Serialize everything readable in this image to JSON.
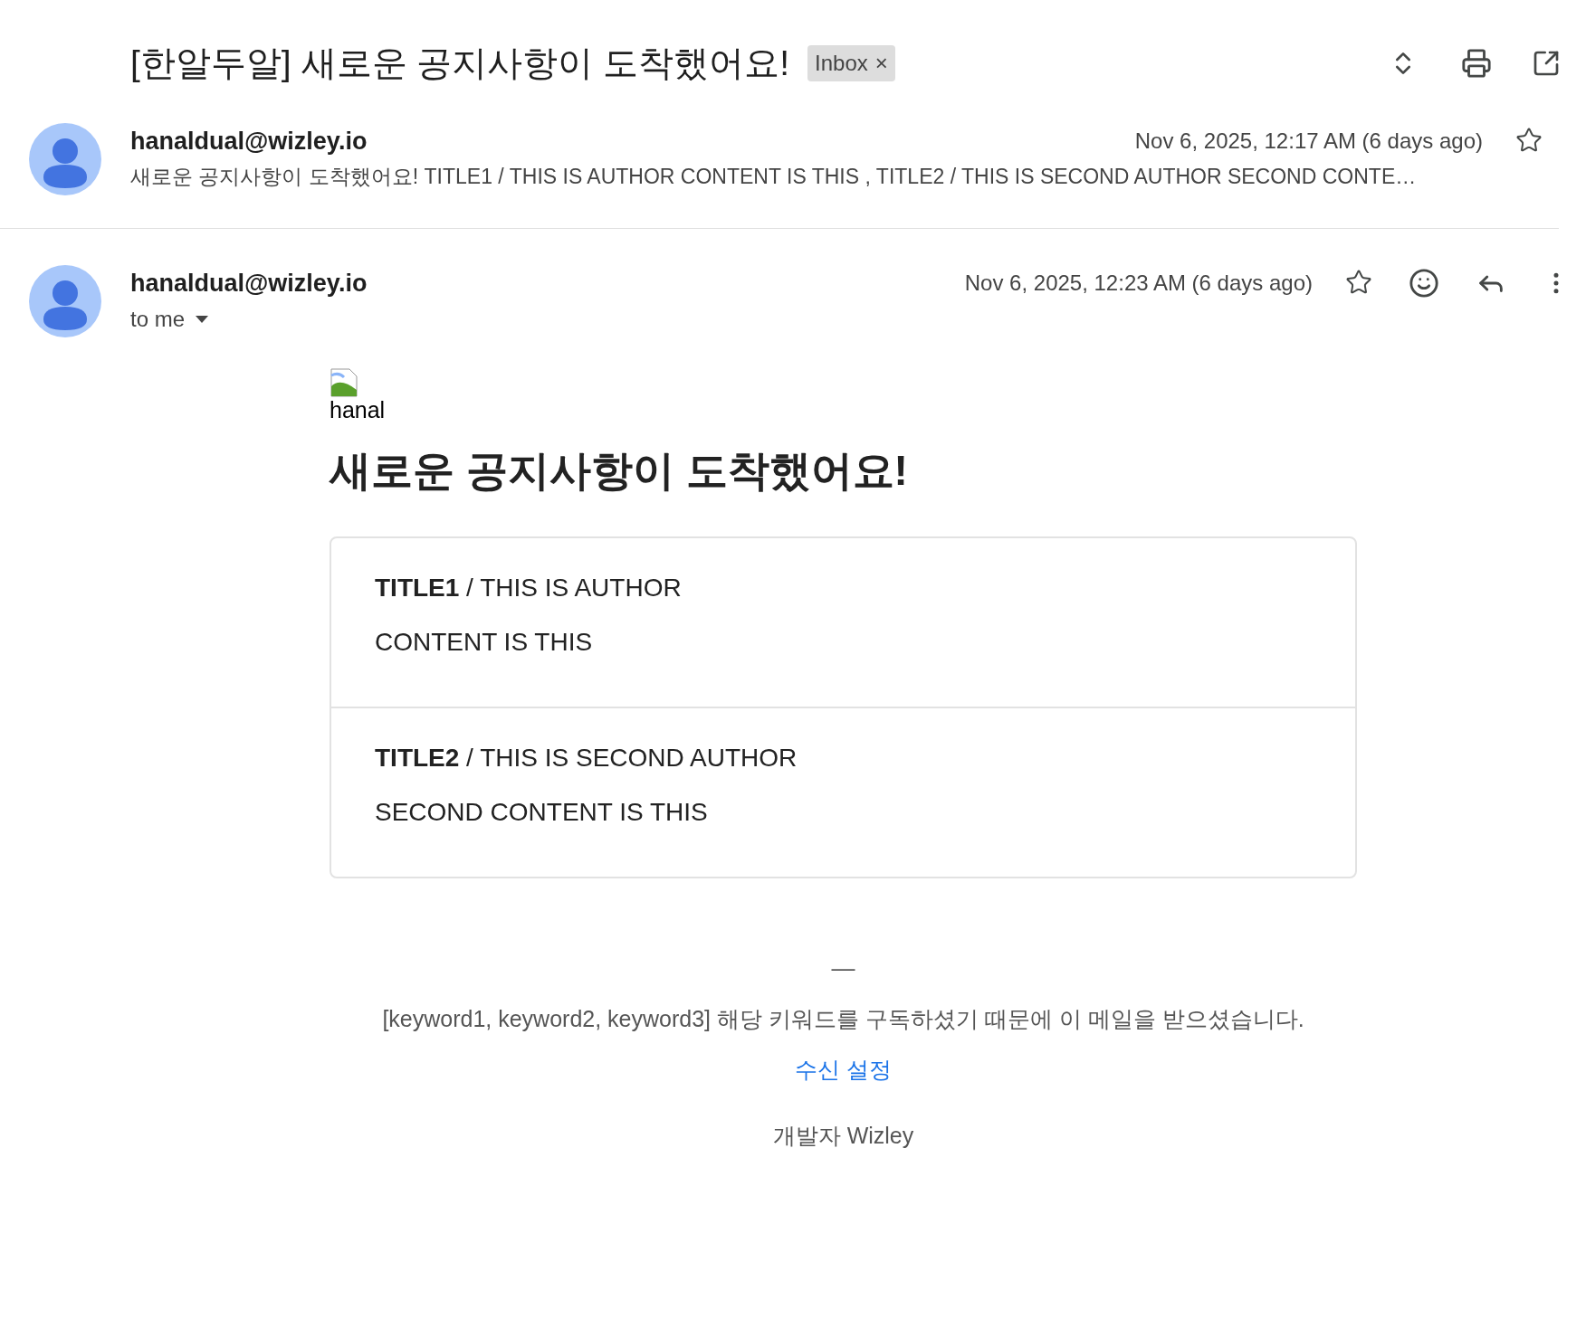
{
  "subject": "[한알두알] 새로운 공지사항이 도착했어요!",
  "label": {
    "text": "Inbox",
    "remove": "×"
  },
  "collapsed_message": {
    "sender": "hanaldual@wizley.io",
    "date": "Nov 6, 2025, 12:17 AM (6 days ago)",
    "starred": false,
    "preview": "새로운 공지사항이 도착했어요! TITLE1 / THIS IS AUTHOR CONTENT IS THIS , TITLE2 / THIS IS SECOND AUTHOR SECOND CONTE…"
  },
  "open_message": {
    "sender": "hanaldual@wizley.io",
    "recipient": "to me",
    "date": "Nov 6, 2025, 12:23 AM (6 days ago)",
    "starred": false
  },
  "body": {
    "logo_alt": "hanal",
    "heading": "새로운 공지사항이 도착했어요!",
    "notices": [
      {
        "headline": "**TITLE1** / THIS IS AUTHOR",
        "content": "CONTENT IS THIS"
      },
      {
        "headline": "**TITLE2** / THIS IS SECOND AUTHOR",
        "content": "SECOND CONTENT IS THIS"
      }
    ],
    "separator": "—",
    "subscription_note": "[keyword1, keyword2, keyword3] 해당 키워드를 구독하셨기 때문에 이 메일을 받으셨습니다.",
    "settings_link": "수신 설정",
    "signature": "개발자 Wizley"
  }
}
